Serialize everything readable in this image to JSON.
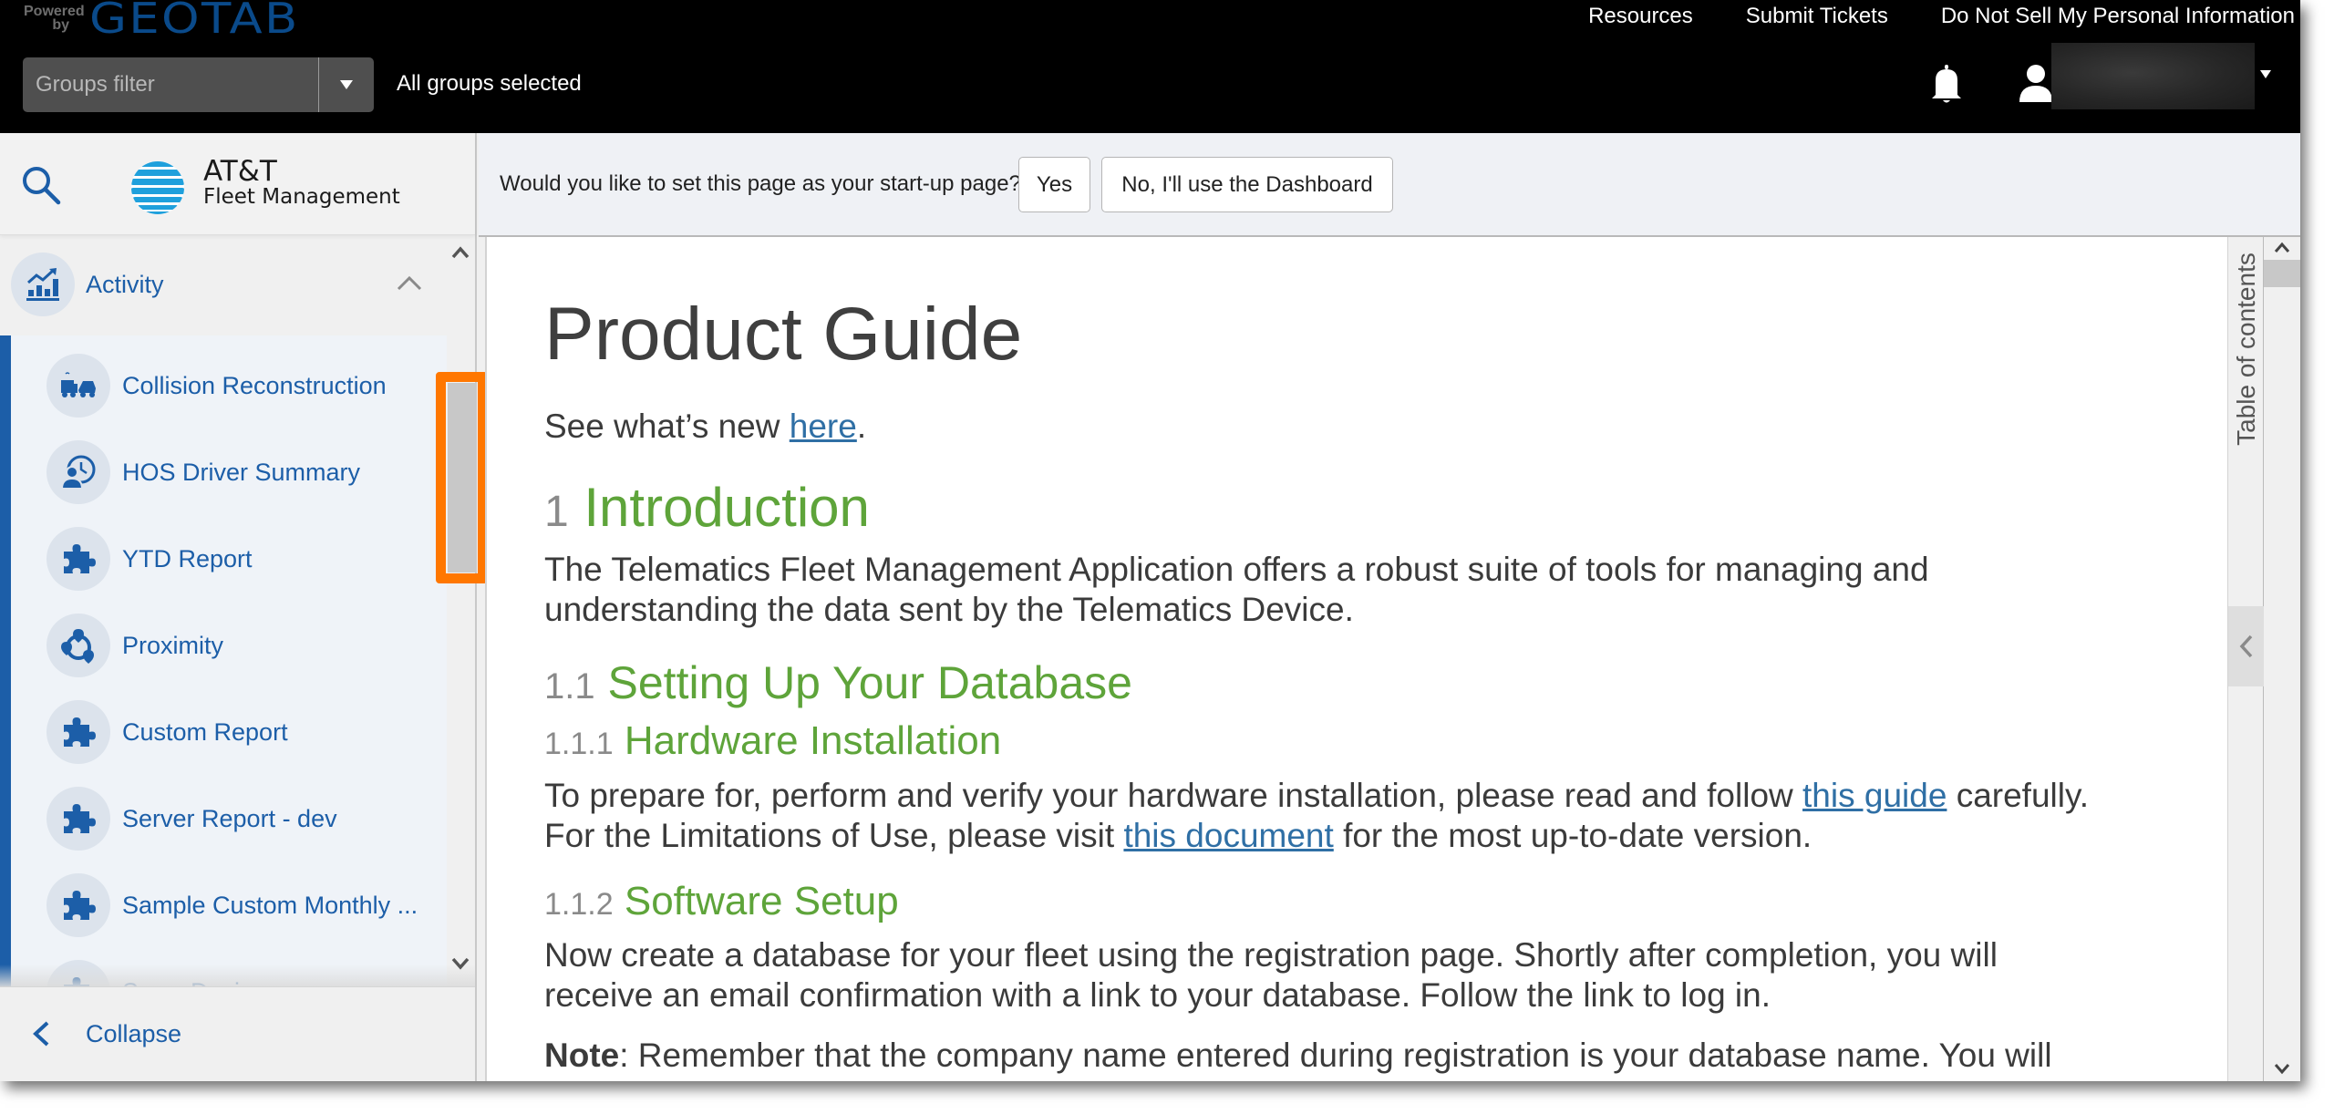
{
  "header": {
    "brand_powered": "Powered by",
    "brand_name": "GEOTAB",
    "links": [
      "Resources",
      "Submit Tickets",
      "Do Not Sell My Personal Information"
    ],
    "groups_filter_placeholder": "Groups filter",
    "groups_status": "All groups selected",
    "notifications_icon": "bell-icon",
    "user_icon": "user-icon",
    "user_name": "(redacted)"
  },
  "sidebar": {
    "brand_title": "AT&T",
    "brand_subtitle": "Fleet Management",
    "accent_color": "#1c5ea8",
    "group": {
      "label": "Activity",
      "icon": "activity-chart-icon",
      "expanded": true
    },
    "items": [
      {
        "label": "Collision Reconstruction",
        "icon": "collision-icon"
      },
      {
        "label": "HOS Driver Summary",
        "icon": "driver-clock-icon"
      },
      {
        "label": "YTD Report",
        "icon": "puzzle-icon"
      },
      {
        "label": "Proximity",
        "icon": "proximity-icon"
      },
      {
        "label": "Custom Report",
        "icon": "puzzle-icon"
      },
      {
        "label": "Server Report - dev",
        "icon": "puzzle-icon"
      },
      {
        "label": "Sample Custom Monthly ...",
        "icon": "puzzle-icon"
      },
      {
        "label": "Swap Device",
        "icon": "puzzle-icon"
      }
    ],
    "collapse_label": "Collapse",
    "highlight_color": "#ff7700"
  },
  "startup_prompt": {
    "question": "Would you like to set this page as your start-up page?",
    "yes_label": "Yes",
    "no_label": "No, I'll use the Dashboard"
  },
  "document": {
    "title": "Product Guide",
    "whats_new_prefix": "See what’s new ",
    "whats_new_link": "here",
    "whats_new_suffix": ".",
    "heading_color": "#5ea43a",
    "sections": [
      {
        "num": "1",
        "title": "Introduction"
      },
      {
        "num": "1.1",
        "title": "Setting Up Your Database"
      },
      {
        "num": "1.1.1",
        "title": "Hardware Installation"
      },
      {
        "num": "1.1.2",
        "title": "Software Setup"
      }
    ],
    "intro_line1": "The Telematics Fleet Management Application offers a robust suite of tools for managing and",
    "intro_line2": "understanding the data sent by the Telematics Device.",
    "hw_line1_prefix": "To prepare for, perform and verify your hardware installation, please read and follow ",
    "hw_line1_link": "this guide",
    "hw_line1_suffix": " carefully.",
    "hw_line2_prefix": "For the Limitations of Use, please visit ",
    "hw_line2_link": "this document",
    "hw_line2_suffix": " for the most up-to-date version.",
    "sw_line1": "Now create a database for your fleet using the registration page. Shortly after completion, you will",
    "sw_line2": "receive an email confirmation with a link to your database. Follow the link to log in.",
    "note_label": "Note",
    "note_text": ": Remember that the company name entered during registration is your database name. You will"
  },
  "toc": {
    "label": "Table of contents"
  }
}
